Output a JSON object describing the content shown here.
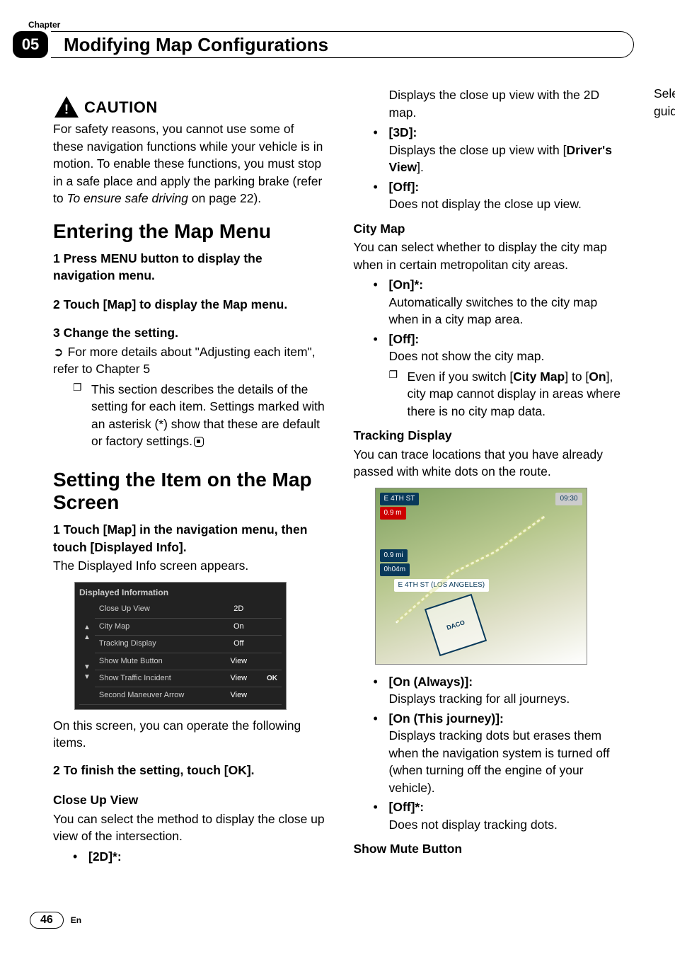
{
  "header": {
    "top_label": "Chapter",
    "chapter_num": "05",
    "title": "Modifying Map Configurations"
  },
  "caution": {
    "label": "CAUTION",
    "body_a": "For safety reasons, you cannot use some of these navigation functions while your vehicle is in motion. To enable these functions, you must stop in a safe place and apply the parking brake (refer to ",
    "body_italic": "To ensure safe driving",
    "body_b": " on page 22)."
  },
  "sec1": {
    "heading": "Entering the Map Menu",
    "step1": "1   Press MENU button to display the navigation menu.",
    "step2": "2   Touch [Map] to display the Map menu.",
    "step3": "3   Change the setting.",
    "ref": "For more details about \"Adjusting each item\", refer to Chapter 5",
    "note1": "This section describes the details of the setting for each item. Settings marked with an asterisk (*) show that these are default or factory settings."
  },
  "sec2": {
    "heading": "Setting the Item on the Map Screen",
    "step1": "1   Touch [Map] in the navigation menu, then touch [Displayed Info].",
    "after1": "The Displayed Info screen appears.",
    "fig": {
      "title": "Displayed Information",
      "rows": [
        {
          "label": "Close Up View",
          "value": "2D"
        },
        {
          "label": "City Map",
          "value": "On"
        },
        {
          "label": "Tracking Display",
          "value": "Off"
        },
        {
          "label": "Show Mute Button",
          "value": "View"
        },
        {
          "label": "Show Traffic Incident",
          "value": "View",
          "ok": "OK"
        },
        {
          "label": "Second Maneuver Arrow",
          "value": "View"
        }
      ]
    },
    "afterfig": "On this screen, you can operate the following items.",
    "step2": "2   To finish the setting, touch [OK].",
    "closeup": {
      "title": "Close Up View",
      "intro": "You can select the method to display the close up view of the intersection.",
      "opts": [
        {
          "label": "[2D]*:",
          "desc": "Displays the close up view with the 2D map."
        },
        {
          "label": "[3D]:",
          "desc_a": "Displays the close up view with [",
          "desc_bold": "Driver's View",
          "desc_b": "]."
        },
        {
          "label": "[Off]:",
          "desc": "Does not display the close up view."
        }
      ]
    },
    "citymap": {
      "title": "City Map",
      "intro": "You can select whether to display the city map when in certain metropolitan city areas.",
      "opts": [
        {
          "label": "[On]*:",
          "desc": "Automatically switches to the city map when in a city map area."
        },
        {
          "label": "[Off]:",
          "desc": "Does not show the city map.",
          "note_a": "Even if you switch [",
          "note_bold1": "City Map",
          "note_mid": "] to [",
          "note_bold2": "On",
          "note_b": "], city map cannot display in areas where there is no city map data."
        }
      ]
    },
    "tracking": {
      "title": "Tracking Display",
      "intro": "You can trace locations that you have already passed with white dots on the route.",
      "map": {
        "l1": "E 4TH ST",
        "l2": "0.9 m",
        "l3": "0.9 mi",
        "l4": "0h04m",
        "l5": "E 4TH ST (LOS ANGELES)",
        "time": "09:30"
      },
      "opts": [
        {
          "label": "[On (Always)]:",
          "desc": "Displays tracking for all journeys."
        },
        {
          "label": "[On (This journey)]:",
          "desc": "Displays tracking dots but erases them when the navigation system is turned off (when turning off the engine of your vehicle)."
        },
        {
          "label": "[Off]*:",
          "desc": "Does not display tracking dots."
        }
      ]
    },
    "mute": {
      "title": "Show Mute Button",
      "intro": "Selects whether to display or hide the voice guidance mute key on the map."
    }
  },
  "footer": {
    "page": "46",
    "lang": "En"
  }
}
